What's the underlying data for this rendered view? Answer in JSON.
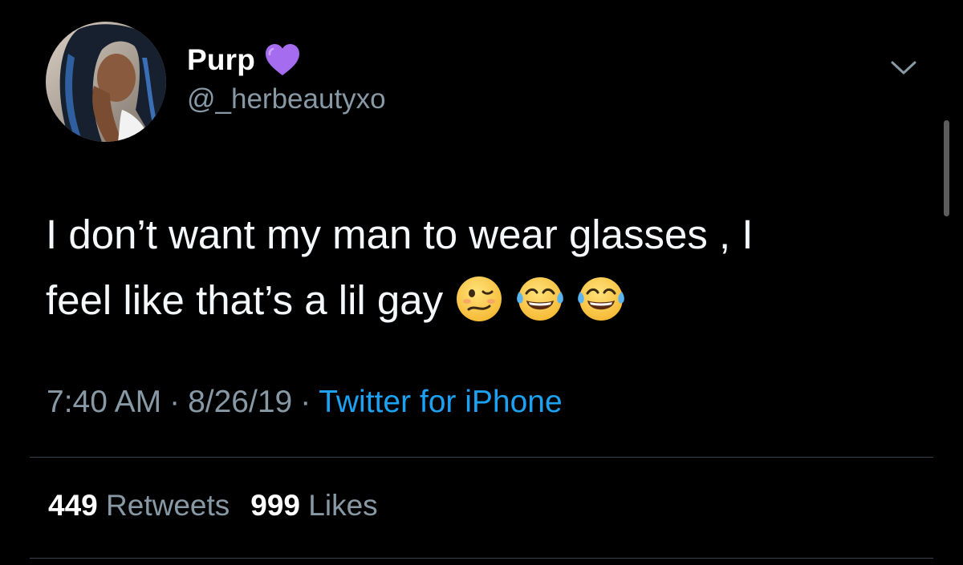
{
  "tweet": {
    "display_name": "Purp",
    "verified_emoji": "purple-heart",
    "handle": "@_herbeautyxo",
    "text_line1": "I don’t want my man to wear glasses , I",
    "text_line2": "feel like that’s a lil gay",
    "emojis": [
      "woozy-face",
      "face-with-tears-of-joy",
      "face-with-tears-of-joy"
    ],
    "time": "7:40 AM",
    "separator": "·",
    "date": "8/26/19",
    "source": "Twitter for iPhone",
    "retweets_count": "449",
    "retweets_label": "Retweets",
    "likes_count": "999",
    "likes_label": "Likes"
  },
  "colors": {
    "background": "#000000",
    "text": "#f5f8fa",
    "secondary_text": "#8899a6",
    "link": "#1da1f2",
    "divider": "#38444d",
    "heart": "#a56cf0"
  },
  "icons": {
    "menu": "chevron-down-icon"
  }
}
